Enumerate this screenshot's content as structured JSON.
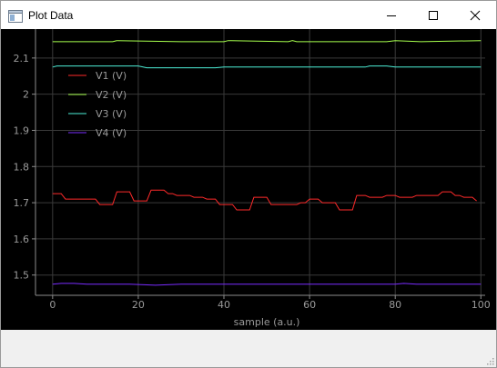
{
  "window": {
    "title": "Plot Data",
    "icons": {
      "app": "window-icon",
      "minimize": "minimize-icon",
      "maximize": "maximize-icon",
      "close": "close-icon"
    }
  },
  "colors": {
    "background": "#000000",
    "grid": "#3a3a3a",
    "axis": "#8c8c8c",
    "tick_text": "#9a9a9a"
  },
  "chart_data": {
    "type": "line",
    "title": "",
    "xlabel": "sample (a.u.)",
    "ylabel": "",
    "xlim": [
      -4,
      101
    ],
    "ylim": [
      1.444,
      2.18
    ],
    "xticks": [
      0,
      20,
      40,
      60,
      80,
      100
    ],
    "yticks": [
      1.5,
      1.6,
      1.7,
      1.8,
      1.9,
      2,
      2.1
    ],
    "ytick_labels": [
      "1.5",
      "1.6",
      "1.7",
      "1.8",
      "1.9",
      "2",
      "2.1"
    ],
    "grid": true,
    "legend_position": "top-left",
    "series": [
      {
        "name": "V1 (V)",
        "color": "#ff2a2a",
        "x": [
          0,
          1,
          2,
          3,
          4,
          5,
          6,
          7,
          8,
          9,
          10,
          11,
          12,
          13,
          14,
          15,
          16,
          17,
          18,
          19,
          20,
          21,
          22,
          23,
          24,
          25,
          26,
          27,
          28,
          29,
          30,
          31,
          32,
          33,
          34,
          35,
          36,
          37,
          38,
          39,
          40,
          41,
          42,
          43,
          44,
          45,
          46,
          47,
          48,
          49,
          50,
          51,
          52,
          53,
          54,
          55,
          56,
          57,
          58,
          59,
          60,
          61,
          62,
          63,
          64,
          65,
          66,
          67,
          68,
          69,
          70,
          71,
          72,
          73,
          74,
          75,
          76,
          77,
          78,
          79,
          80,
          81,
          82,
          83,
          84,
          85,
          86,
          87,
          88,
          89,
          90,
          91,
          92,
          93,
          94,
          95,
          96,
          97,
          98,
          99
        ],
        "values": [
          1.725,
          1.725,
          1.725,
          1.71,
          1.71,
          1.71,
          1.71,
          1.71,
          1.71,
          1.71,
          1.71,
          1.695,
          1.695,
          1.695,
          1.695,
          1.73,
          1.73,
          1.73,
          1.73,
          1.705,
          1.705,
          1.705,
          1.705,
          1.735,
          1.735,
          1.735,
          1.735,
          1.725,
          1.725,
          1.72,
          1.72,
          1.72,
          1.72,
          1.715,
          1.715,
          1.715,
          1.71,
          1.71,
          1.71,
          1.695,
          1.695,
          1.695,
          1.695,
          1.68,
          1.68,
          1.68,
          1.68,
          1.715,
          1.715,
          1.715,
          1.715,
          1.695,
          1.695,
          1.695,
          1.695,
          1.695,
          1.695,
          1.695,
          1.7,
          1.7,
          1.71,
          1.71,
          1.71,
          1.7,
          1.7,
          1.7,
          1.7,
          1.68,
          1.68,
          1.68,
          1.68,
          1.72,
          1.72,
          1.72,
          1.715,
          1.715,
          1.715,
          1.715,
          1.72,
          1.72,
          1.72,
          1.715,
          1.715,
          1.715,
          1.715,
          1.72,
          1.72,
          1.72,
          1.72,
          1.72,
          1.72,
          1.73,
          1.73,
          1.73,
          1.72,
          1.72,
          1.715,
          1.715,
          1.715,
          1.705
        ]
      },
      {
        "name": "V2 (V)",
        "color": "#a6ff4d",
        "x": [
          0,
          10,
          14,
          15,
          30,
          40,
          41,
          55,
          56,
          57,
          78,
          80,
          86,
          100
        ],
        "values": [
          2.145,
          2.145,
          2.145,
          2.148,
          2.145,
          2.145,
          2.148,
          2.145,
          2.148,
          2.145,
          2.145,
          2.148,
          2.145,
          2.148
        ]
      },
      {
        "name": "V3 (V)",
        "color": "#4df0d8",
        "x": [
          0,
          1,
          2,
          10,
          20,
          22,
          28,
          38,
          40,
          46,
          50,
          60,
          73,
          74,
          78,
          80,
          85,
          100
        ],
        "values": [
          2.075,
          2.078,
          2.078,
          2.078,
          2.078,
          2.073,
          2.073,
          2.073,
          2.075,
          2.075,
          2.075,
          2.075,
          2.075,
          2.078,
          2.078,
          2.075,
          2.075,
          2.075
        ]
      },
      {
        "name": "V4 (V)",
        "color": "#7a2cff",
        "x": [
          0,
          2,
          5,
          8,
          18,
          24,
          30,
          48,
          70,
          80,
          82,
          85,
          100
        ],
        "values": [
          1.475,
          1.477,
          1.477,
          1.475,
          1.475,
          1.472,
          1.475,
          1.475,
          1.475,
          1.475,
          1.477,
          1.475,
          1.475
        ]
      }
    ]
  }
}
